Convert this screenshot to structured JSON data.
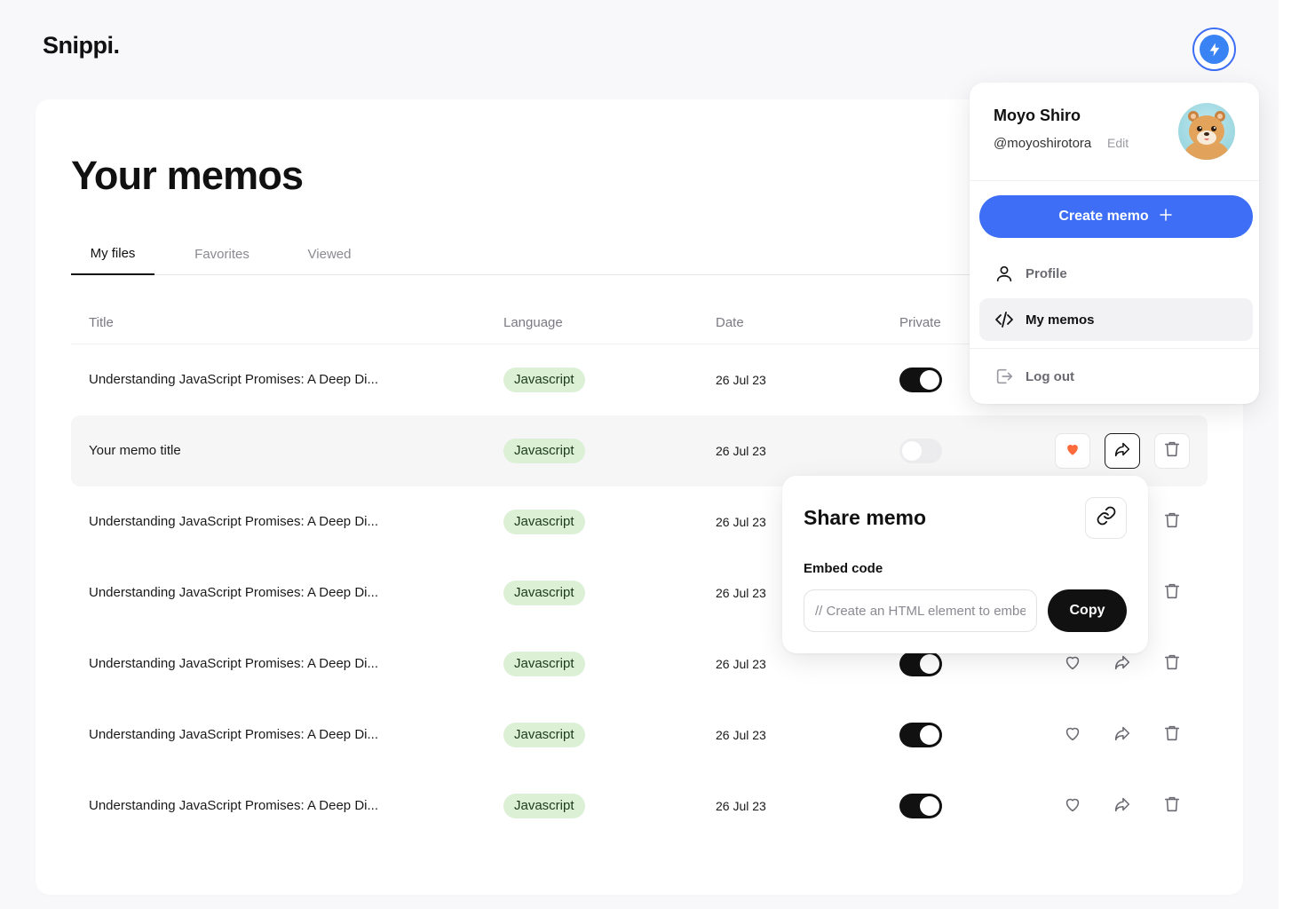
{
  "app": {
    "logo": "Snippi."
  },
  "page": {
    "title": "Your memos"
  },
  "tabs": [
    {
      "label": "My files",
      "active": true
    },
    {
      "label": "Favorites",
      "active": false
    },
    {
      "label": "Viewed",
      "active": false
    }
  ],
  "table": {
    "columns": {
      "title": "Title",
      "language": "Language",
      "date": "Date",
      "private": "Private"
    },
    "rows": [
      {
        "title": "Understanding JavaScript Promises: A Deep Di...",
        "language": "Javascript",
        "date": "26 Jul 23",
        "private": true,
        "liked": false
      },
      {
        "title": "Your memo title",
        "language": "Javascript",
        "date": "26 Jul 23",
        "private": false,
        "liked": true,
        "hovered": true
      },
      {
        "title": "Understanding JavaScript Promises: A Deep Di...",
        "language": "Javascript",
        "date": "26 Jul 23",
        "private": true,
        "liked": false
      },
      {
        "title": "Understanding JavaScript Promises: A Deep Di...",
        "language": "Javascript",
        "date": "26 Jul 23",
        "private": true,
        "liked": false
      },
      {
        "title": "Understanding JavaScript Promises: A Deep Di...",
        "language": "Javascript",
        "date": "26 Jul 23",
        "private": true,
        "liked": false
      },
      {
        "title": "Understanding JavaScript Promises: A Deep Di...",
        "language": "Javascript",
        "date": "26 Jul 23",
        "private": true,
        "liked": false
      },
      {
        "title": "Understanding JavaScript Promises: A Deep Di...",
        "language": "Javascript",
        "date": "26 Jul 23",
        "private": true,
        "liked": false
      }
    ]
  },
  "share": {
    "title": "Share memo",
    "embed_label": "Embed code",
    "embed_placeholder": "// Create an HTML element to embed",
    "copy_label": "Copy"
  },
  "profile": {
    "name": "Moyo Shiro",
    "handle": "@moyoshirotora",
    "edit_label": "Edit",
    "create_label": "Create memo",
    "menu": [
      {
        "label": "Profile",
        "icon": "user-icon",
        "selected": false
      },
      {
        "label": "My memos",
        "icon": "code-icon",
        "selected": true
      },
      {
        "label": "Log out",
        "icon": "logout-icon",
        "selected": false
      }
    ]
  },
  "colors": {
    "accent": "#3d6ef5",
    "badge_bg": "#dcf0d6",
    "like": "#ff6a3d",
    "toggle_on": "#111111"
  }
}
